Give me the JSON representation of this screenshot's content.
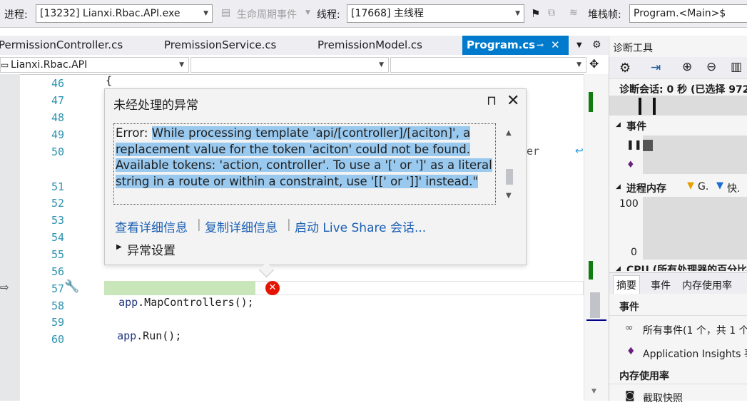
{
  "debug_toolbar": {
    "process_label": "进程:",
    "process_value": "[13232] Lianxi.Rbac.API.exe",
    "lifecycle_label": "生命周期事件",
    "thread_label": "线程:",
    "thread_value": "[17668] 主线程",
    "stackframe_label": "堆栈帧:",
    "stackframe_value": "Program.<Main>$"
  },
  "tabs": [
    {
      "label": "PermissionController.cs"
    },
    {
      "label": "PremissionService.cs"
    },
    {
      "label": "PremissionModel.cs"
    },
    {
      "label": "Program.cs"
    }
  ],
  "nav": {
    "project": "Lianxi.Rbac.API"
  },
  "editor": {
    "brace_line": "{",
    "lines": [
      "46",
      "47",
      "48",
      "49",
      "50",
      "51",
      "52",
      "53",
      "54",
      "55",
      "56",
      "57",
      "58",
      "59",
      "60"
    ],
    "code_57_a": "app",
    "code_57_b": ".MapControllers();",
    "code_59_a": "app",
    "code_59_b": ".Run();",
    "hidden_fragment": "er"
  },
  "exception": {
    "title": "未经处理的异常",
    "error_prefix": "Error: ",
    "message": "While processing template 'api/[controller]/[aciton]', a replacement value for the token 'aciton' could not be found. Available tokens: 'action, controller'. To use a '[' or ']' as a literal string in a route or within a constraint, use '[[' or ']]' instead.\"",
    "link_details": "查看详细信息",
    "link_copy": "复制详细信息",
    "link_liveshare": "启动 Live Share 会话...",
    "settings_label": "异常设置"
  },
  "diagnostics": {
    "title": "诊断工具",
    "session": "诊断会话: 0 秒 (已选择 972",
    "events_label": "事件",
    "memory_label": "进程内存",
    "legend_g": "G.",
    "legend_fast": "快.",
    "axis_top": "100",
    "axis_bottom": "0",
    "cpu_label": "CPU (所有处理器的百分比",
    "tabs": [
      "摘要",
      "事件",
      "内存使用率"
    ],
    "section_events": "事件",
    "all_events": "所有事件(1 个，共 1 个",
    "app_insights": "Application Insights 事",
    "section_memory": "内存使用率",
    "snapshot": "截取快照"
  }
}
